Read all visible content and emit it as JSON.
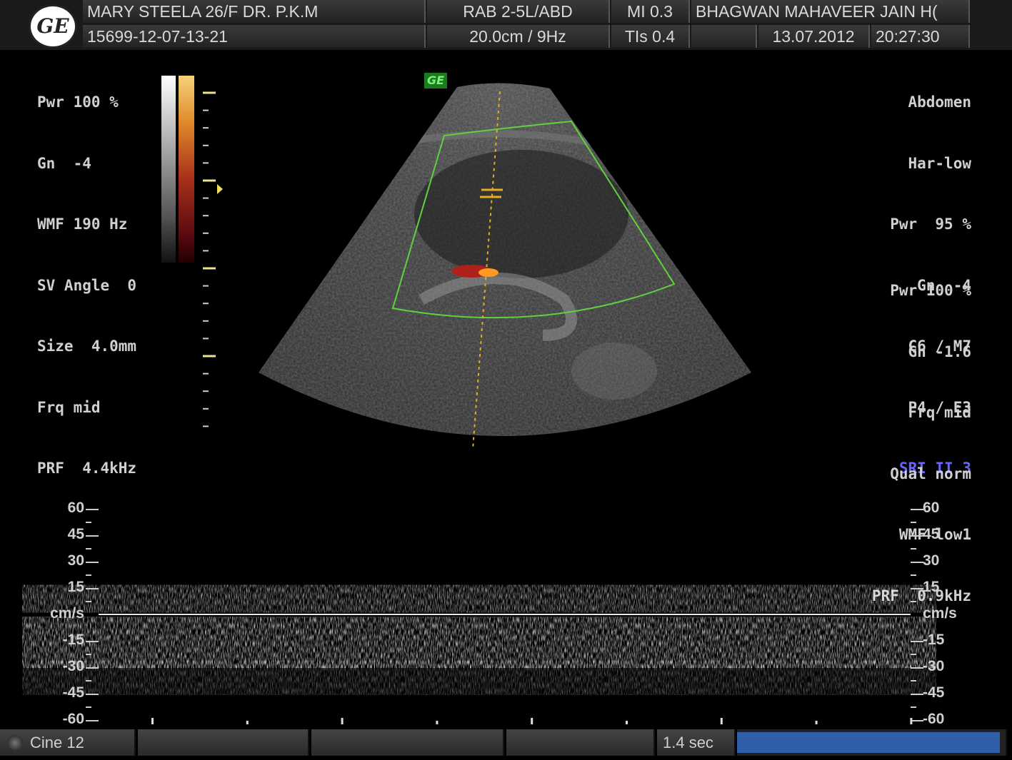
{
  "header": {
    "logo_text": "GE",
    "patient": "MARY  STEELA  26/F DR. P.K.M",
    "patient_id": "15699-12-07-13-21",
    "probe": "RAB 2-5L/ABD",
    "depth_freq": "20.0cm /  9Hz",
    "mi": "MI  0.3",
    "tis": "TIs  0.4",
    "institution": "BHAGWAN MAHAVEER JAIN H(",
    "date": "13.07.2012",
    "time": "20:27:30"
  },
  "left_params": [
    "Pwr 100 %",
    "Gn  -4",
    "WMF 190 Hz",
    "SV Angle  0",
    "Size  4.0mm",
    "Frq mid",
    "PRF  4.4kHz"
  ],
  "right_params_top": [
    "Abdomen",
    "Har-low",
    "Pwr  95 %",
    "Gn  -4",
    "C6 / M7",
    "P4 / E3"
  ],
  "right_sri": "SRI II 3",
  "right_params_bottom": [
    "Pwr 100 %",
    "Gn -1.6",
    "Frq mid",
    "Qual norm",
    "WMF low1",
    "PRF  0.9kHz"
  ],
  "ge_mark": "GE",
  "doppler": {
    "unit": "cm/s",
    "left_scale": [
      "60",
      "45",
      "30",
      "15",
      "cm/s",
      "-15",
      "-30",
      "-45",
      "-60"
    ],
    "right_scale": [
      "60",
      "45",
      "30",
      "15",
      "cm/s",
      "-15",
      "-30",
      "-45",
      "-60"
    ]
  },
  "bottom_bar": {
    "cine": "Cine 12",
    "duration": "1.4 sec",
    "progress_fraction": 1.0,
    "progress_color": "#2f5fa8"
  },
  "colors": {
    "roi_box": "#5fd23f",
    "cursor_line": "#e0b020",
    "flow_red": "#b0201a",
    "flow_orange": "#ff9a20"
  }
}
